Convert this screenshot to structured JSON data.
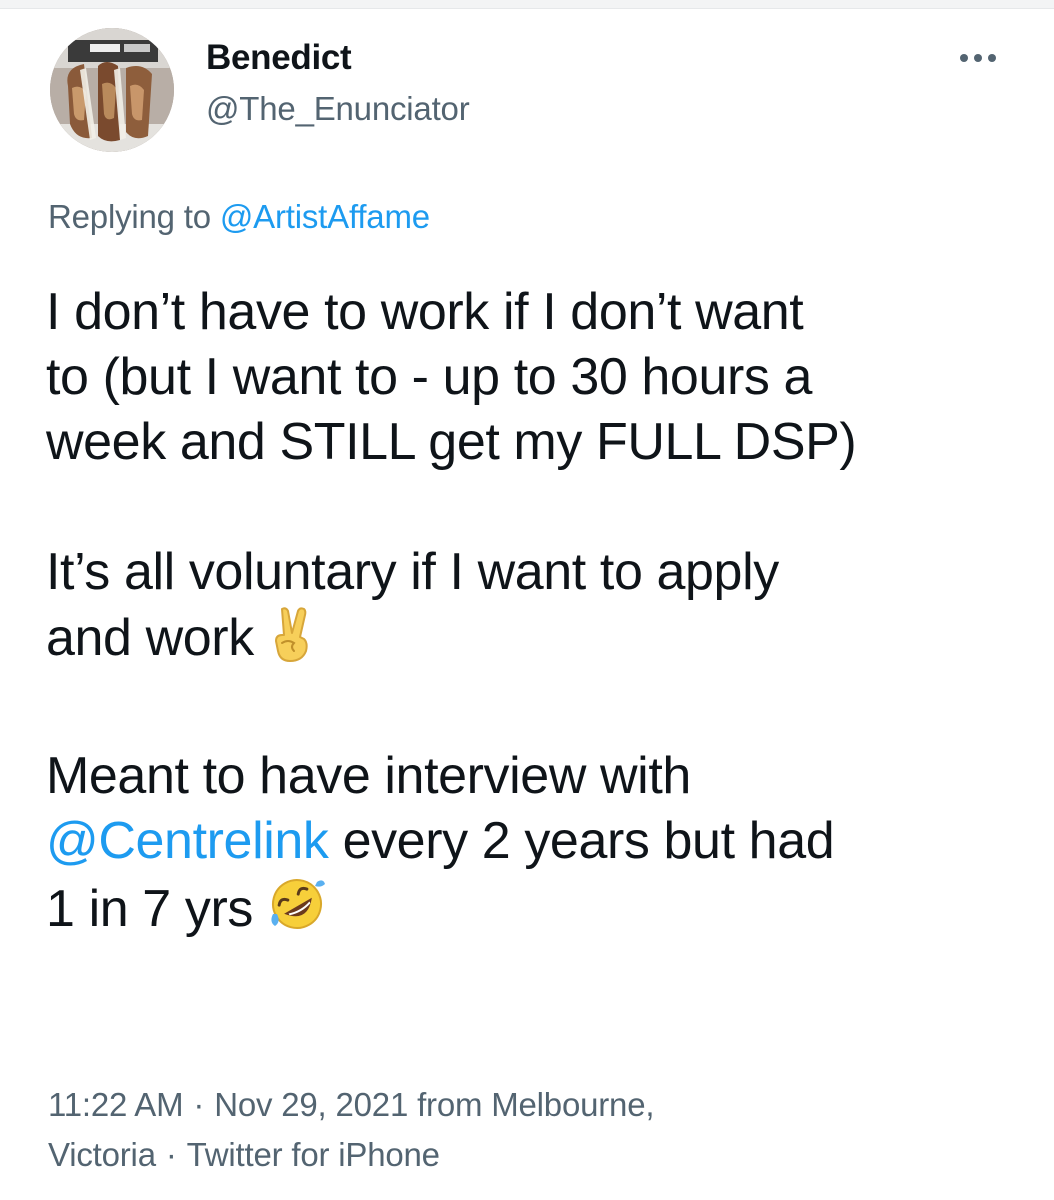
{
  "user": {
    "display_name": "Benedict",
    "handle": "@The_Enunciator"
  },
  "reply": {
    "prefix": "Replying to",
    "mention": "@ArtistAffame"
  },
  "tweet": {
    "line1": "I don’t have to work if I don’t want",
    "line2": "to (but I want to - up to 30 hours a",
    "line3": "week and STILL get my FULL DSP)",
    "line4": "It’s all voluntary if I want to apply",
    "line5": "and work",
    "line6": "Meant to have interview with",
    "line7_mention": "@Centrelink",
    "line7_rest": "every 2 years but had",
    "line8": "1 in 7 yrs",
    "emoji_1": "victory-hand-emoji",
    "emoji_2": "rolling-on-floor-laughing-emoji"
  },
  "meta": {
    "time": "11:22 AM",
    "date_location": "Nov 29, 2021 from Melbourne,",
    "location_cont": "Victoria",
    "client": "Twitter for iPhone"
  },
  "colors": {
    "text": "#0f1419",
    "secondary": "#536471",
    "link": "#1d9bf0"
  },
  "icons": {
    "more": "more-horizontal-icon"
  }
}
